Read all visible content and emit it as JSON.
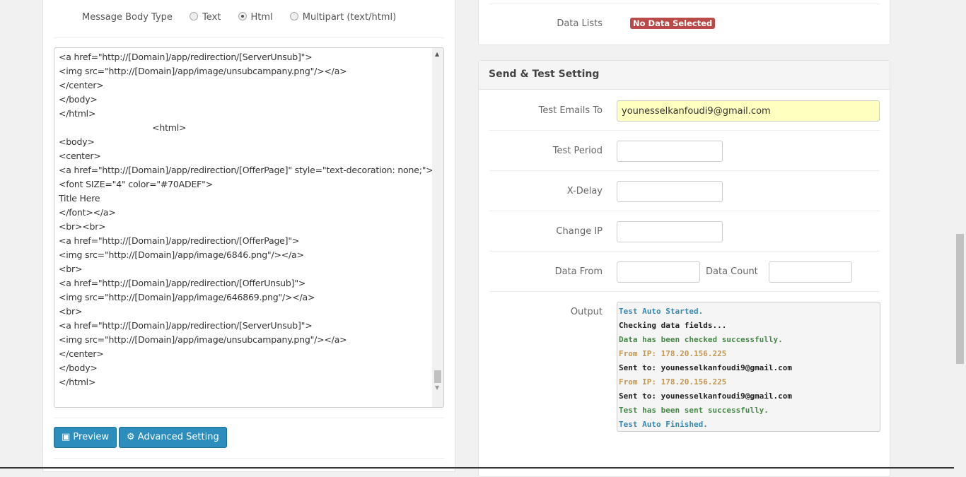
{
  "body_type": {
    "label": "Message Body Type",
    "options": [
      "Text",
      "Html",
      "Multipart (text/html)"
    ],
    "selected": "Html"
  },
  "editor_lines": [
    "<a href=\"http://[Domain]/app/redirection/[ServerUnsub]\">",
    "<img src=\"http://[Domain]/app/image/unsubcampany.png\"/></a>",
    "</center>",
    "</body>",
    "</html>",
    "                                   <html>",
    "<body>",
    "<center>",
    "<a href=\"http://[Domain]/app/redirection/[OfferPage]\" style=\"text-decoration: none;\">",
    "<font SIZE=\"4\" color=\"#70ADEF\">",
    "Title Here",
    "</font></a>",
    "<br><br>",
    "<a href=\"http://[Domain]/app/redirection/[OfferPage]\">",
    "<img src=\"http://[Domain]/app/image/6846.png\"/></a>",
    "<br>",
    "<a href=\"http://[Domain]/app/redirection/[OfferUnsub]\">",
    "<img src=\"http://[Domain]/app/image/646869.png\"/></a>",
    "<br>",
    "<a href=\"http://[Domain]/app/redirection/[ServerUnsub]\">",
    "<img src=\"http://[Domain]/app/image/unsubcampany.png\"/></a>",
    "</center>",
    "</body>",
    "</html>"
  ],
  "buttons": {
    "preview": "Preview",
    "advanced": "Advanced Setting"
  },
  "data_lists": {
    "label": "Data Lists",
    "badge": "No Data Selected",
    "badge_color": "#b94a48"
  },
  "send_test": {
    "title": "Send & Test Setting",
    "test_emails_label": "Test Emails To",
    "test_emails_value": "younesselkanfoudi9@gmail.com",
    "test_period_label": "Test Period",
    "x_delay_label": "X-Delay",
    "change_ip_label": "Change IP",
    "data_from_label": "Data From",
    "data_count_label": "Data Count",
    "output_label": "Output",
    "output": [
      {
        "text": "Test Auto Started.",
        "color": "#3a87ad"
      },
      {
        "text": "Checking data fields...",
        "color": "#222222"
      },
      {
        "text": "Data has been checked successfully.",
        "color": "#468847"
      },
      {
        "text": "From IP: 178.20.156.225",
        "color": "#c09853"
      },
      {
        "text": "Sent to: younesselkanfoudi9@gmail.com",
        "color": "#222222"
      },
      {
        "text": "From IP: 178.20.156.225",
        "color": "#c09853"
      },
      {
        "text": "Sent to: younesselkanfoudi9@gmail.com",
        "color": "#222222"
      },
      {
        "text": "Test has been sent successfully.",
        "color": "#468847"
      },
      {
        "text": "Test Auto Finished.",
        "color": "#3a87ad"
      }
    ]
  }
}
